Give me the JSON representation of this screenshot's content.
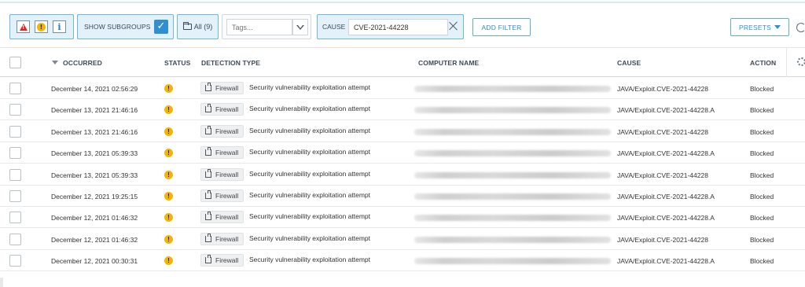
{
  "toolbar": {
    "show_subgroups_label": "SHOW SUBGROUPS",
    "show_subgroups_checked": true,
    "all_groups_label": "All (9)",
    "tags_placeholder": "Tags...",
    "cause_label": "CAUSE",
    "cause_value": "CVE-2021-44228",
    "add_filter_label": "ADD FILTER",
    "presets_label": "PRESETS",
    "severity_icons": [
      "error-icon",
      "warning-icon",
      "info-icon"
    ]
  },
  "table": {
    "headers": {
      "occurred": "OCCURRED",
      "status": "STATUS",
      "detection_type": "DETECTION TYPE",
      "computer_name": "COMPUTER NAME",
      "cause": "CAUSE",
      "action": "ACTION"
    },
    "rows": [
      {
        "occurred": "December 14, 2021 02:56:29",
        "status": "warning",
        "type": "Firewall",
        "detection": "Security vulnerability exploitation attempt",
        "cause": "JAVA/Exploit.CVE-2021-44228",
        "action": "Blocked"
      },
      {
        "occurred": "December 13, 2021 21:46:16",
        "status": "warning",
        "type": "Firewall",
        "detection": "Security vulnerability exploitation attempt",
        "cause": "JAVA/Exploit.CVE-2021-44228.A",
        "action": "Blocked"
      },
      {
        "occurred": "December 13, 2021 21:46:16",
        "status": "warning",
        "type": "Firewall",
        "detection": "Security vulnerability exploitation attempt",
        "cause": "JAVA/Exploit.CVE-2021-44228",
        "action": "Blocked"
      },
      {
        "occurred": "December 13, 2021 05:39:33",
        "status": "warning",
        "type": "Firewall",
        "detection": "Security vulnerability exploitation attempt",
        "cause": "JAVA/Exploit.CVE-2021-44228.A",
        "action": "Blocked"
      },
      {
        "occurred": "December 13, 2021 05:39:33",
        "status": "warning",
        "type": "Firewall",
        "detection": "Security vulnerability exploitation attempt",
        "cause": "JAVA/Exploit.CVE-2021-44228",
        "action": "Blocked"
      },
      {
        "occurred": "December 12, 2021 19:25:15",
        "status": "warning",
        "type": "Firewall",
        "detection": "Security vulnerability exploitation attempt",
        "cause": "JAVA/Exploit.CVE-2021-44228.A",
        "action": "Blocked"
      },
      {
        "occurred": "December 12, 2021 01:46:32",
        "status": "warning",
        "type": "Firewall",
        "detection": "Security vulnerability exploitation attempt",
        "cause": "JAVA/Exploit.CVE-2021-44228.A",
        "action": "Blocked"
      },
      {
        "occurred": "December 12, 2021 01:46:32",
        "status": "warning",
        "type": "Firewall",
        "detection": "Security vulnerability exploitation attempt",
        "cause": "JAVA/Exploit.CVE-2021-44228",
        "action": "Blocked"
      },
      {
        "occurred": "December 12, 2021 00:30:31",
        "status": "warning",
        "type": "Firewall",
        "detection": "Security vulnerability exploitation attempt",
        "cause": "JAVA/Exploit.CVE-2021-44228.A",
        "action": "Blocked"
      }
    ]
  },
  "colors": {
    "accent": "#2f8fd1",
    "filter_bg": "#e3f1fa",
    "filter_border": "#6bb7de",
    "warning": "#f5b400",
    "error": "#e02424"
  }
}
